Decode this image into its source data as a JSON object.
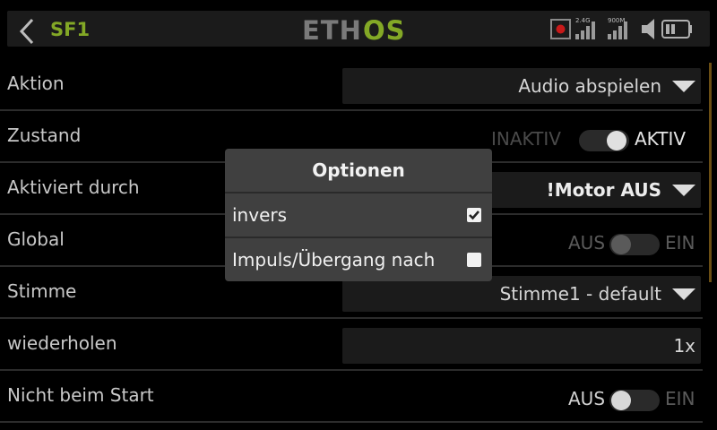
{
  "header": {
    "title": "SF1",
    "logo": "ETHOS",
    "status": {
      "rssi_24_label": "2.4G",
      "rssi_900_label": "900M"
    }
  },
  "rows": [
    {
      "label": "Aktion",
      "value": "Audio abspielen"
    },
    {
      "label": "Zustand",
      "off_label": "INAKTIV",
      "on_label": "AKTIV",
      "state": "on"
    },
    {
      "label": "Aktiviert durch",
      "value": "!Motor AUS"
    },
    {
      "label": "Global",
      "off_label": "AUS",
      "on_label": "EIN",
      "state": "off"
    },
    {
      "label": "Stimme",
      "value": "Stimme1 - default"
    },
    {
      "label": "wiederholen",
      "value": "1x"
    },
    {
      "label": "Nicht beim Start",
      "off_label": "AUS",
      "on_label": "EIN",
      "state": "off"
    }
  ],
  "modal": {
    "title": "Optionen",
    "options": [
      {
        "label": "invers",
        "checked": true
      },
      {
        "label": "Impuls/Übergang nach",
        "checked": false
      }
    ]
  },
  "colors": {
    "accent_green": "#83a826",
    "background": "#000000",
    "field": "#1b1b1b",
    "modal": "#404040",
    "record_red": "#c81a1a"
  }
}
